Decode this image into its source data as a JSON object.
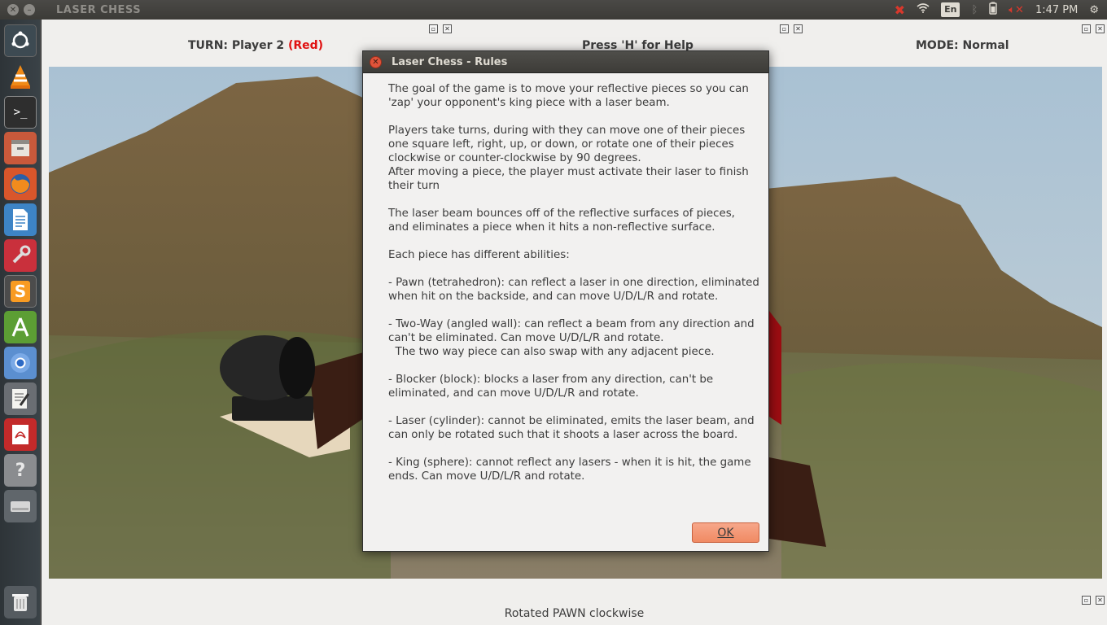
{
  "top_panel": {
    "app_title": "LASER CHESS",
    "keyboard_layout": "En",
    "clock": "1:47 PM"
  },
  "launcher": {
    "items": [
      "ubuntu-dash",
      "vlc",
      "terminal",
      "files",
      "firefox",
      "libreoffice-writer",
      "system-settings",
      "sublime-text",
      "android-studio",
      "chromium",
      "text-editor",
      "pdf-viewer",
      "help",
      "drive",
      "trash"
    ]
  },
  "app": {
    "turn_label": "TURN: Player 2 ",
    "turn_player": "(Red)",
    "turn_player_color": "#e01010",
    "help_hint": "Press 'H' for Help",
    "mode_label": "MODE: Normal",
    "status_message": "Rotated PAWN clockwise"
  },
  "dialog": {
    "title": "Laser Chess - Rules",
    "paragraphs": [
      "The goal of the game is to move your reflective pieces so you can\n'zap' your opponent's king piece with a laser beam.",
      "Players take turns, during with they can move one of their pieces\none square left, right, up, or down, or rotate one of their pieces\nclockwise or counter-clockwise by 90 degrees.\nAfter moving a piece, the player must activate their laser to finish\ntheir turn",
      "The laser beam bounces off of the reflective surfaces of pieces,\nand eliminates a piece when it hits a non-reflective surface.",
      "Each piece has different abilities:",
      "- Pawn (tetrahedron): can reflect a laser in one direction, eliminated\nwhen hit on the backside, and can move U/D/L/R and rotate.",
      "- Two-Way (angled wall): can reflect a beam from any direction and\ncan't be eliminated. Can move U/D/L/R and rotate.\n  The two way piece can also swap with any adjacent piece.",
      "- Blocker (block): blocks a laser from any direction, can't be\neliminated, and can move U/D/L/R and rotate.",
      "- Laser (cylinder): cannot be eliminated, emits the laser beam, and\ncan only be rotated such that it shoots a laser across the board.",
      "- King (sphere): cannot reflect any lasers - when it is hit, the game\nends. Can move U/D/L/R and rotate."
    ],
    "ok_label": "OK"
  }
}
